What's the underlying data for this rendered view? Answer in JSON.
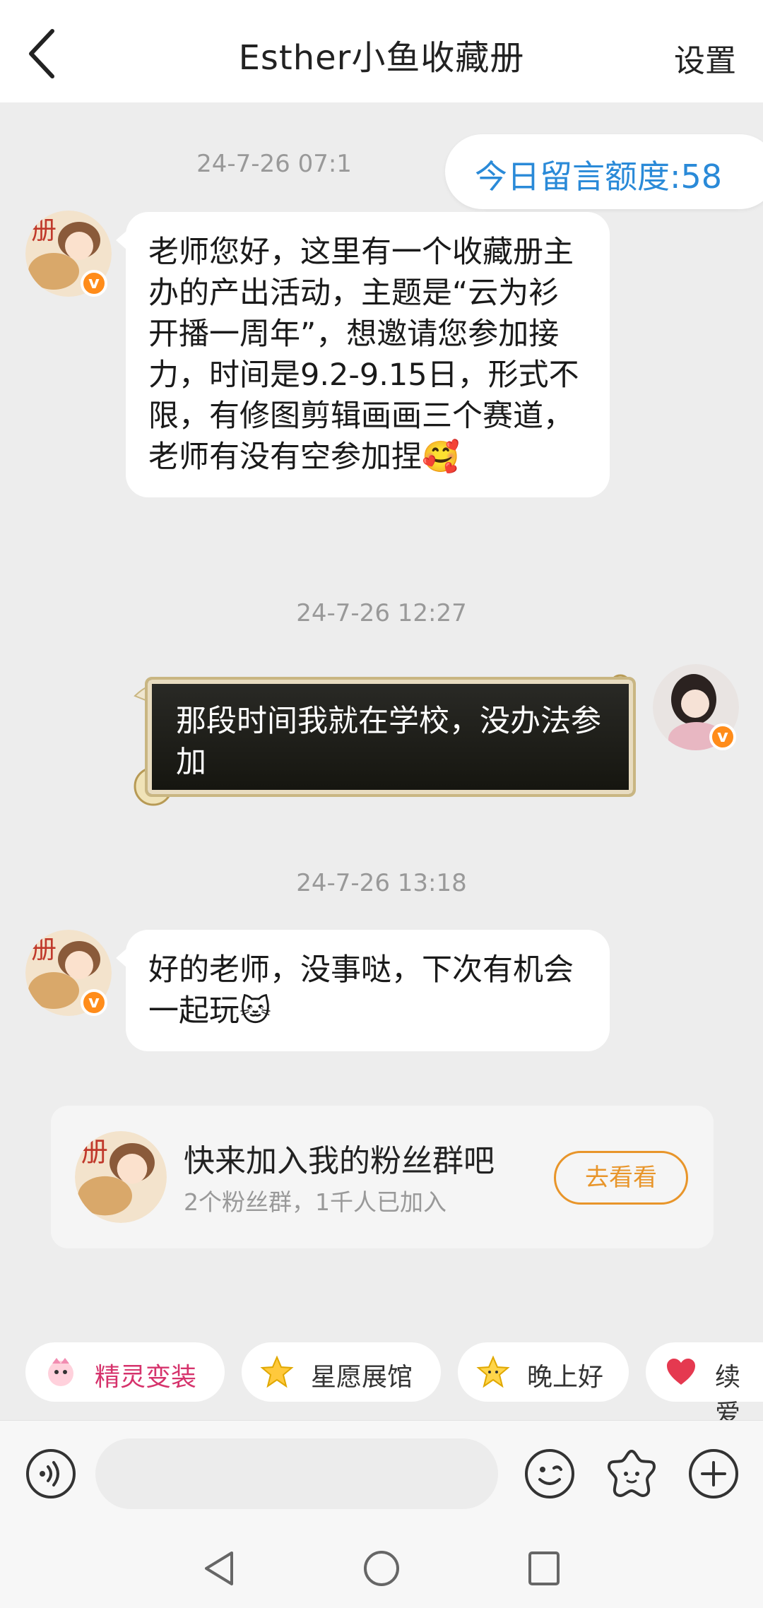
{
  "header": {
    "title": "Esther小鱼收藏册",
    "settings_label": "设置"
  },
  "quota": {
    "label": "今日留言额度:58"
  },
  "messages": [
    {
      "time": "24-7-26 07:1",
      "text": "老师您好，这里有一个收藏册主办的产出活动，主题是“云为衫开播一周年”，想邀请您参加接力，时间是9.2-9.15日，形式不限，有修图剪辑画画三个赛道，老师有没有空参加捏🥰"
    },
    {
      "time": "24-7-26 12:27",
      "text": "那段时间我就在学校，没办法参加"
    },
    {
      "time": "24-7-26 13:18",
      "text": "好的老师，没事哒，下次有机会一起玩🐱"
    }
  ],
  "fan_card": {
    "title": "快来加入我的粉丝群吧",
    "subtitle": "2个粉丝群，1千人已加入",
    "button": "去看看"
  },
  "chips": [
    {
      "label": "精灵变装",
      "icon": "sprite-icon",
      "color": "#d6336c"
    },
    {
      "label": "星愿展馆",
      "icon": "star-icon",
      "color": "#333333"
    },
    {
      "label": "晚上好",
      "icon": "star-face-icon",
      "color": "#333333"
    },
    {
      "label": "续爱",
      "icon": "heart-icon",
      "color": "#333333"
    }
  ],
  "colors": {
    "accent": "#2a8ad8",
    "orange": "#e8952a",
    "badge": "#ff8c1a"
  }
}
